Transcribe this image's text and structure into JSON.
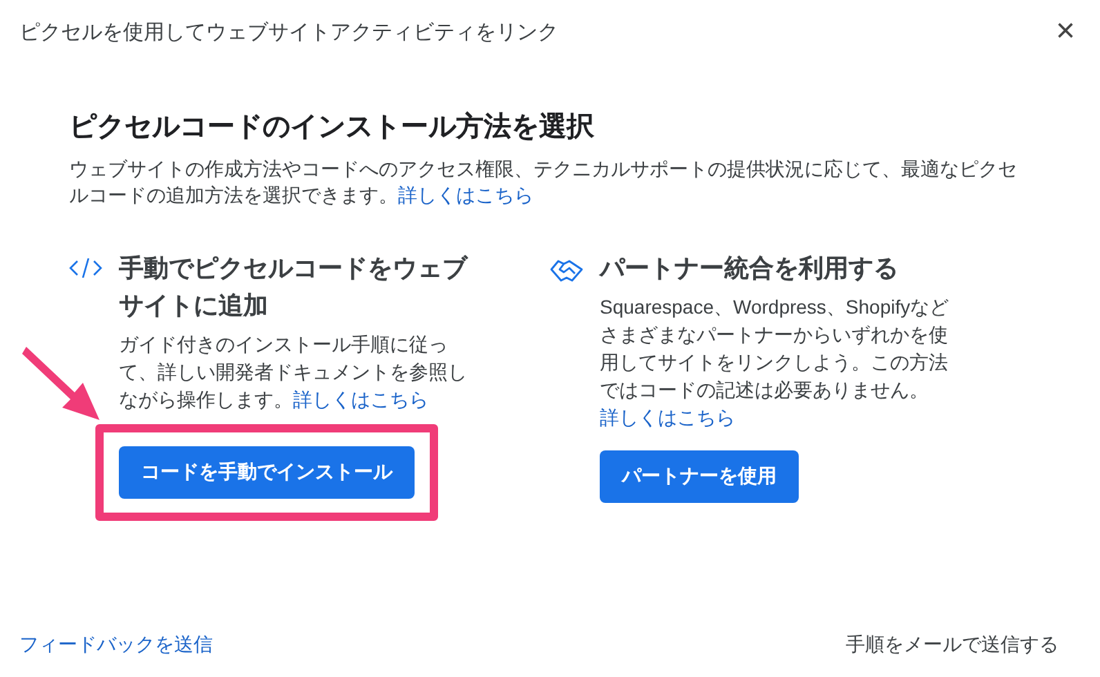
{
  "window": {
    "title": "ピクセルを使用してウェブサイトアクティビティをリンク",
    "close": "×"
  },
  "heading": "ピクセルコードのインストール方法を選択",
  "description": {
    "text": "ウェブサイトの作成方法やコードへのアクセス権限、テクニカルサポートの提供状況に応じて、最適なピクセルコードの追加方法を選択できます。",
    "link": "詳しくはこちら"
  },
  "options": [
    {
      "kind": "code",
      "title": "手動でピクセルコードをウェブサイトに追加",
      "text": "ガイド付きのインストール手順に従って、詳しい開発者ドキュメントを参照しながら操作します。",
      "link": "詳しくはこちら",
      "button": "コードを手動でインストール",
      "highlighted": true
    },
    {
      "kind": "partner",
      "title": "パートナー統合を利用する",
      "text": "Squarespace、Wordpress、Shopifyなどさまざまなパートナーからいずれかを使用してサイトをリンクしよう。この方法ではコードの記述は必要ありません。",
      "link": "詳しくはこちら",
      "button": "パートナーを使用",
      "highlighted": false
    }
  ],
  "footer": {
    "feedback": "フィードバックを送信",
    "email": "手順をメールで送信する"
  }
}
